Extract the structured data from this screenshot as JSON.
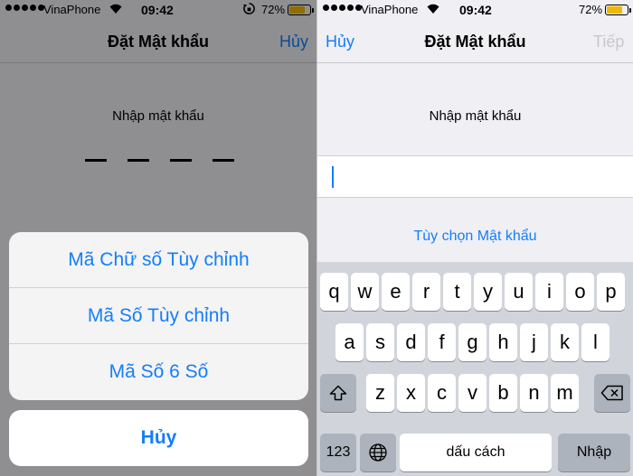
{
  "status": {
    "carrier": "VinaPhone",
    "time": "09:42",
    "battery": "72%",
    "battery_level": 0.72,
    "battery_color": "#f0b800",
    "icons": [
      "signal-dots-icon",
      "wifi-icon",
      "rotation-lock-icon",
      "battery-icon"
    ]
  },
  "left": {
    "title": "Đặt Mật khẩu",
    "cancel": "Hủy",
    "prompt": "Nhập mật khẩu",
    "passcode_length": 4,
    "sheet_options": [
      "Mã Chữ số Tùy chỉnh",
      "Mã Số Tùy chỉnh",
      "Mã Số 6 Số"
    ],
    "sheet_cancel": "Hủy"
  },
  "right": {
    "title": "Đặt Mật khẩu",
    "cancel": "Hủy",
    "next": "Tiếp",
    "prompt": "Nhập mật khẩu",
    "options_link": "Tùy chọn Mật khẩu",
    "keyboard": {
      "row1": [
        "q",
        "w",
        "e",
        "r",
        "t",
        "y",
        "u",
        "i",
        "o",
        "p"
      ],
      "row2": [
        "a",
        "s",
        "d",
        "f",
        "g",
        "h",
        "j",
        "k",
        "l"
      ],
      "row3": [
        "z",
        "x",
        "c",
        "v",
        "b",
        "n",
        "m"
      ],
      "shift": "shift-icon",
      "backspace": "backspace-icon",
      "numbers": "123",
      "globe": "globe-icon",
      "space": "dấu cách",
      "return": "Nhập"
    }
  },
  "colors": {
    "accent": "#147efb",
    "disabled": "#c7c7cc",
    "keyboard_bg": "#d1d5db"
  }
}
